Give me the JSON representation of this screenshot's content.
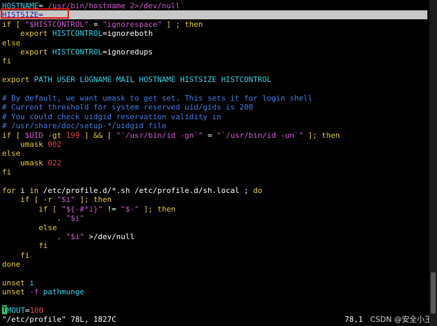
{
  "colors": {
    "background": "#000000",
    "default": "#ffffff",
    "keyword": "#e6cf29",
    "variable": "#33d6e6",
    "string": "#d05ad0",
    "comment": "#3f7fe6",
    "number": "#e04848",
    "highlight_row": "#c8c8c8",
    "highlight_text": "#1a1aa8",
    "annotation_border": "#ee1111",
    "cursor": "#33cc66"
  },
  "editor": {
    "cursor_char": "T",
    "lines": [
      [
        {
          "t": "HOSTNAME",
          "c": "variable"
        },
        {
          "t": "= ",
          "c": "default"
        },
        {
          "t": "/usr/bin/hostname 2>/dev/null`",
          "c": "string"
        }
      ],
      [
        {
          "t": "HISTSIZE",
          "c": "highlight_text"
        },
        {
          "t": "=",
          "c": "highlight_text"
        }
      ],
      [
        {
          "t": "if [ ",
          "c": "keyword"
        },
        {
          "t": "\"$HISTCONTROL\"",
          "c": "string"
        },
        {
          "t": " = ",
          "c": "default"
        },
        {
          "t": "\"ignorespace\"",
          "c": "string"
        },
        {
          "t": " ] ; then",
          "c": "keyword"
        }
      ],
      [
        {
          "t": "    export ",
          "c": "keyword"
        },
        {
          "t": "HISTCONTROL",
          "c": "variable"
        },
        {
          "t": "=ignoreboth",
          "c": "default"
        }
      ],
      [
        {
          "t": "else",
          "c": "keyword"
        }
      ],
      [
        {
          "t": "    export ",
          "c": "keyword"
        },
        {
          "t": "HISTCONTROL",
          "c": "variable"
        },
        {
          "t": "=ignoredups",
          "c": "default"
        }
      ],
      [
        {
          "t": "fi",
          "c": "keyword"
        }
      ],
      [],
      [
        {
          "t": "export ",
          "c": "keyword"
        },
        {
          "t": "PATH USER LOGNAME MAIL HOSTNAME HISTSIZE HISTCONTROL",
          "c": "variable"
        }
      ],
      [],
      [
        {
          "t": "# By default, we want umask to get set. This sets it for login shell",
          "c": "comment"
        }
      ],
      [
        {
          "t": "# Current threshold for system reserved uid/gids is 200",
          "c": "comment"
        }
      ],
      [
        {
          "t": "# You could check uidgid reservation validity in",
          "c": "comment"
        }
      ],
      [
        {
          "t": "# /usr/share/doc/setup-*/uidgid file",
          "c": "comment"
        }
      ],
      [
        {
          "t": "if [ ",
          "c": "keyword"
        },
        {
          "t": "$UID",
          "c": "string"
        },
        {
          "t": " -gt ",
          "c": "keyword"
        },
        {
          "t": "199",
          "c": "number"
        },
        {
          "t": " ] && [ ",
          "c": "keyword"
        },
        {
          "t": "\"`/usr/bin/id -gn`\"",
          "c": "string"
        },
        {
          "t": " = ",
          "c": "default"
        },
        {
          "t": "\"`/usr/bin/id -un`\"",
          "c": "string"
        },
        {
          "t": " ]; then",
          "c": "keyword"
        }
      ],
      [
        {
          "t": "    umask ",
          "c": "keyword"
        },
        {
          "t": "002",
          "c": "number"
        }
      ],
      [
        {
          "t": "else",
          "c": "keyword"
        }
      ],
      [
        {
          "t": "    umask ",
          "c": "keyword"
        },
        {
          "t": "022",
          "c": "number"
        }
      ],
      [
        {
          "t": "fi",
          "c": "keyword"
        }
      ],
      [],
      [
        {
          "t": "for ",
          "c": "keyword"
        },
        {
          "t": "i ",
          "c": "default"
        },
        {
          "t": "in ",
          "c": "keyword"
        },
        {
          "t": "/etc/profile.d/*.sh /etc/profile.d/sh.local ; ",
          "c": "default"
        },
        {
          "t": "do",
          "c": "keyword"
        }
      ],
      [
        {
          "t": "    if [ -r ",
          "c": "keyword"
        },
        {
          "t": "\"$i\"",
          "c": "string"
        },
        {
          "t": " ]; then",
          "c": "keyword"
        }
      ],
      [
        {
          "t": "        if [ ",
          "c": "keyword"
        },
        {
          "t": "\"${-#*i}\"",
          "c": "string"
        },
        {
          "t": " != ",
          "c": "default"
        },
        {
          "t": "\"$-\"",
          "c": "string"
        },
        {
          "t": " ]; then",
          "c": "keyword"
        }
      ],
      [
        {
          "t": "            . ",
          "c": "keyword"
        },
        {
          "t": "\"$i\"",
          "c": "string"
        }
      ],
      [
        {
          "t": "        else",
          "c": "keyword"
        }
      ],
      [
        {
          "t": "            . ",
          "c": "keyword"
        },
        {
          "t": "\"$i\"",
          "c": "string"
        },
        {
          "t": " >/dev/null",
          "c": "default"
        }
      ],
      [
        {
          "t": "        fi",
          "c": "keyword"
        }
      ],
      [
        {
          "t": "    fi",
          "c": "keyword"
        }
      ],
      [
        {
          "t": "done",
          "c": "keyword"
        }
      ],
      [],
      [
        {
          "t": "unset ",
          "c": "keyword"
        },
        {
          "t": "i",
          "c": "variable"
        }
      ],
      [
        {
          "t": "unset ",
          "c": "keyword"
        },
        {
          "t": "-f ",
          "c": "string"
        },
        {
          "t": "pathmunge",
          "c": "variable"
        }
      ],
      [],
      [
        {
          "t": "MOUT",
          "c": "variable"
        },
        {
          "t": "=",
          "c": "default"
        },
        {
          "t": "100",
          "c": "number"
        }
      ]
    ]
  },
  "status": {
    "file_info": "\"/etc/profile\" 78L, 1827C",
    "cursor_position": "78,1",
    "watermark": "CSDN @安全小王"
  }
}
